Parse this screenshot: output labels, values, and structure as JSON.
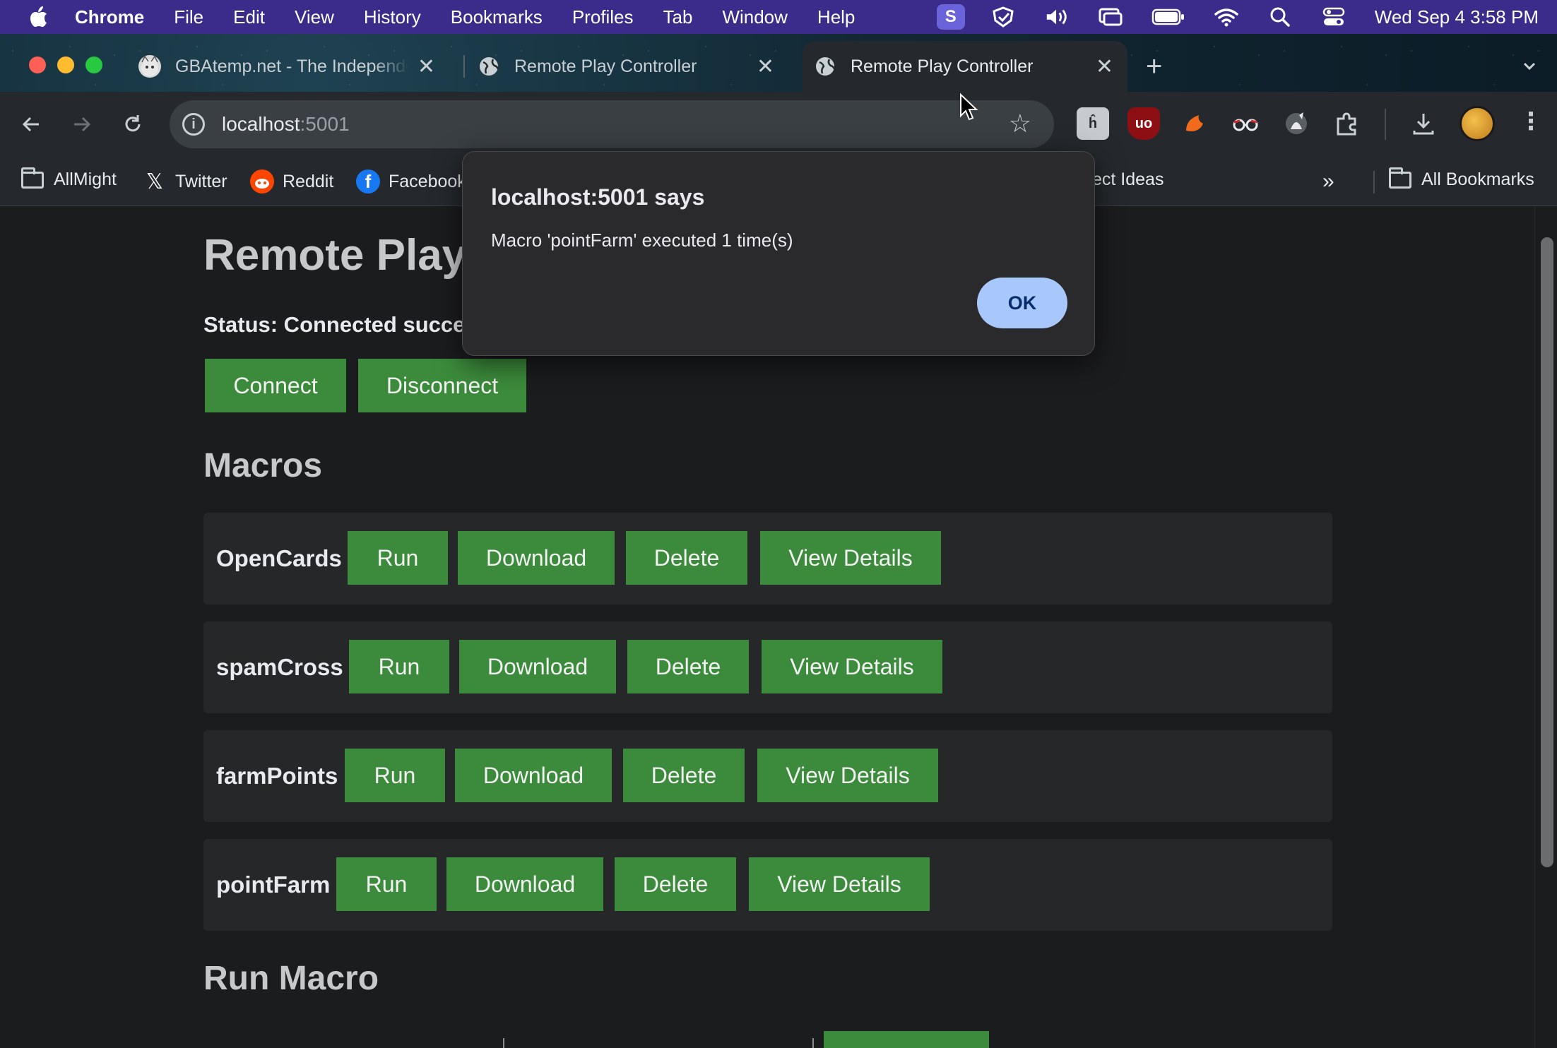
{
  "menubar": {
    "app_name": "Chrome",
    "items": [
      "File",
      "Edit",
      "View",
      "History",
      "Bookmarks",
      "Profiles",
      "Tab",
      "Window",
      "Help"
    ],
    "clock": "Wed Sep 4  3:58 PM"
  },
  "tabs": [
    {
      "title": "GBAtemp.net - The Independent",
      "icon": "gbatemp-icon"
    },
    {
      "title": "Remote Play Controller",
      "icon": "globe-icon"
    },
    {
      "title": "Remote Play Controller",
      "icon": "globe-icon",
      "active": true
    }
  ],
  "omnibox": {
    "host": "localhost",
    "port": ":5001"
  },
  "bookmarks": {
    "items": [
      {
        "label": "AllMight",
        "icon": "folder-icon"
      },
      {
        "label": "Twitter",
        "icon": "x-icon"
      },
      {
        "label": "Reddit",
        "icon": "reddit-icon"
      },
      {
        "label": "Facebook",
        "icon": "facebook-icon"
      },
      {
        "label": "ect Ideas",
        "icon": "none"
      }
    ],
    "overflow": "»",
    "all_bookmarks": "All Bookmarks"
  },
  "page": {
    "title": "Remote Play Controller",
    "status": "Status: Connected successfully",
    "connect_label": "Connect",
    "disconnect_label": "Disconnect",
    "macros_heading": "Macros",
    "run_macro_heading": "Run Macro",
    "macros": [
      {
        "name": "OpenCards",
        "run": "Run",
        "download": "Download",
        "delete": "Delete",
        "details": "View Details"
      },
      {
        "name": "spamCross",
        "run": "Run",
        "download": "Download",
        "delete": "Delete",
        "details": "View Details"
      },
      {
        "name": "farmPoints",
        "run": "Run",
        "download": "Download",
        "delete": "Delete",
        "details": "View Details"
      },
      {
        "name": "pointFarm",
        "run": "Run",
        "download": "Download",
        "delete": "Delete",
        "details": "View Details"
      }
    ]
  },
  "dialog": {
    "title": "localhost:5001 says",
    "message": "Macro 'pointFarm' executed 1 time(s)",
    "ok_label": "OK"
  },
  "colors": {
    "button_green": "#3c8b3c",
    "menubar_purple": "#3b2c8c",
    "ok_blue": "#a8c7fa"
  }
}
